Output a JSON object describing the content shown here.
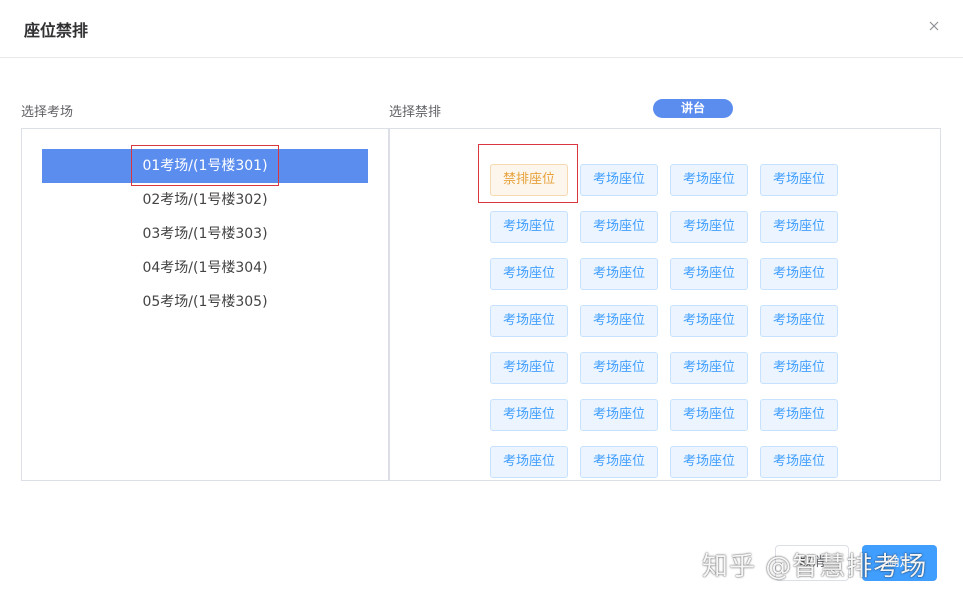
{
  "dialog": {
    "title": "座位禁排"
  },
  "left_panel": {
    "label": "选择考场",
    "rooms": [
      {
        "label": "01考场/(1号楼301)",
        "active": true
      },
      {
        "label": "02考场/(1号楼302)",
        "active": false
      },
      {
        "label": "03考场/(1号楼303)",
        "active": false
      },
      {
        "label": "04考场/(1号楼304)",
        "active": false
      },
      {
        "label": "05考场/(1号楼305)",
        "active": false
      }
    ]
  },
  "right_panel": {
    "label": "选择禁排",
    "podium_label": "讲台",
    "seats": [
      "禁排座位",
      "考场座位",
      "考场座位",
      "考场座位",
      "考场座位",
      "考场座位",
      "考场座位",
      "考场座位",
      "考场座位",
      "考场座位",
      "考场座位",
      "考场座位",
      "考场座位",
      "考场座位",
      "考场座位",
      "考场座位",
      "考场座位",
      "考场座位",
      "考场座位",
      "考场座位",
      "考场座位",
      "考场座位",
      "考场座位",
      "考场座位",
      "考场座位",
      "考场座位",
      "考场座位",
      "考场座位"
    ]
  },
  "footer": {
    "cancel_label": "取消",
    "confirm_label": "确定"
  },
  "watermark": "知乎 @智慧排考场",
  "colors": {
    "primary": "#5b8def",
    "seat_bg": "#ecf5ff",
    "seat_text": "#409eff",
    "banned_bg": "#fdf6ec",
    "banned_text": "#e6a23c",
    "highlight": "#d9363e"
  }
}
